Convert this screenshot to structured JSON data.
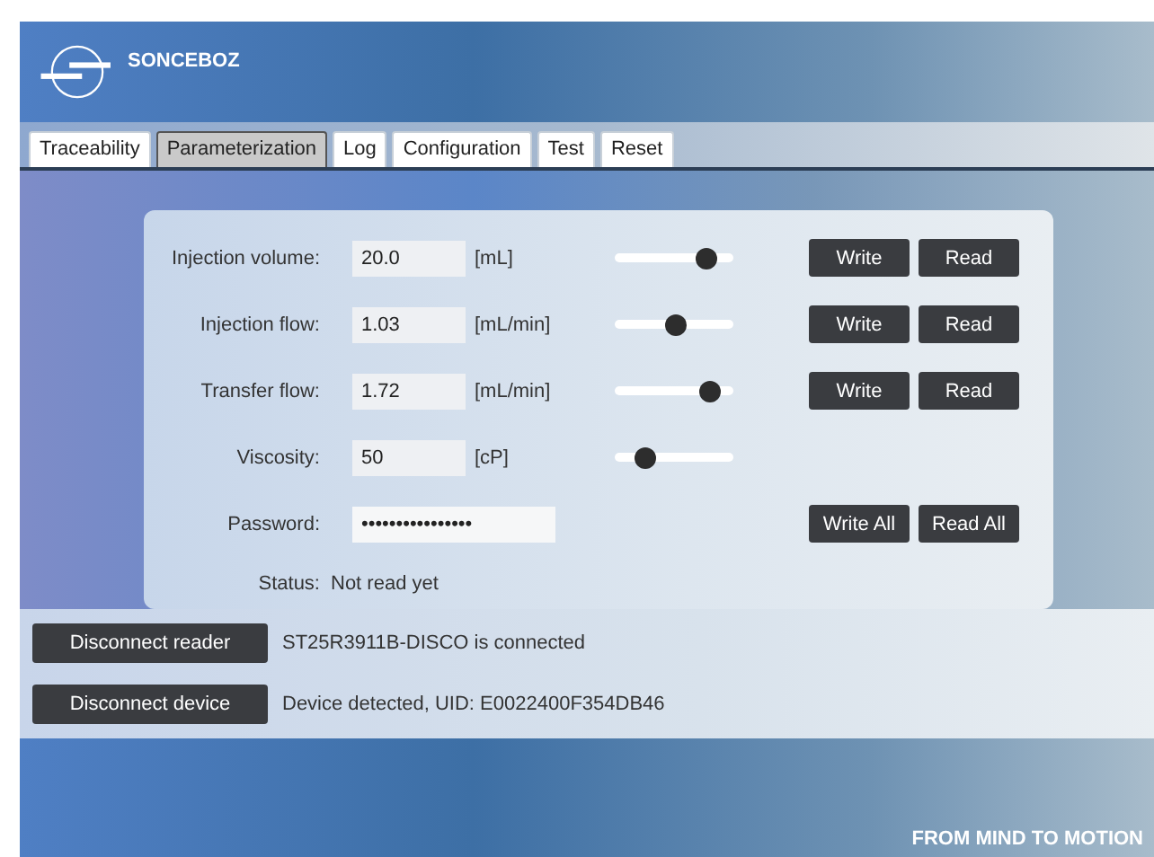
{
  "header": {
    "brand": "SONCEBOZ"
  },
  "tabs": [
    {
      "label": "Traceability",
      "selected": false
    },
    {
      "label": "Parameterization",
      "selected": true
    },
    {
      "label": "Log",
      "selected": false
    },
    {
      "label": "Configuration",
      "selected": false
    },
    {
      "label": "Test",
      "selected": false
    },
    {
      "label": "Reset",
      "selected": false
    }
  ],
  "parameters": [
    {
      "kind": "slider",
      "label": "Injection volume:",
      "value": "20.0",
      "unit": "[mL]",
      "level": 0.78,
      "buttons": [
        "Write",
        "Read"
      ]
    },
    {
      "kind": "slider",
      "label": "Injection flow:",
      "value": "1.03",
      "unit": "[mL/min]",
      "level": 0.52,
      "buttons": [
        "Write",
        "Read"
      ]
    },
    {
      "kind": "slider",
      "label": "Transfer flow:",
      "value": "1.72",
      "unit": "[mL/min]",
      "level": 0.8,
      "buttons": [
        "Write",
        "Read"
      ]
    },
    {
      "kind": "slider",
      "label": "Viscosity:",
      "value": "50",
      "unit": "[cP]",
      "level": 0.25
    },
    {
      "kind": "password",
      "label": "Password:",
      "value": "••••••••••••••••",
      "buttons": [
        "Write All",
        "Read All"
      ]
    }
  ],
  "status": {
    "label": "Status:",
    "value": "Not read yet"
  },
  "connections": [
    {
      "button": "Disconnect reader",
      "message": "ST25R3911B-DISCO is connected"
    },
    {
      "button": "Disconnect device",
      "message": "Device detected, UID: E0022400F354DB46"
    }
  ],
  "footer": {
    "tagline": "FROM MIND TO MOTION"
  }
}
